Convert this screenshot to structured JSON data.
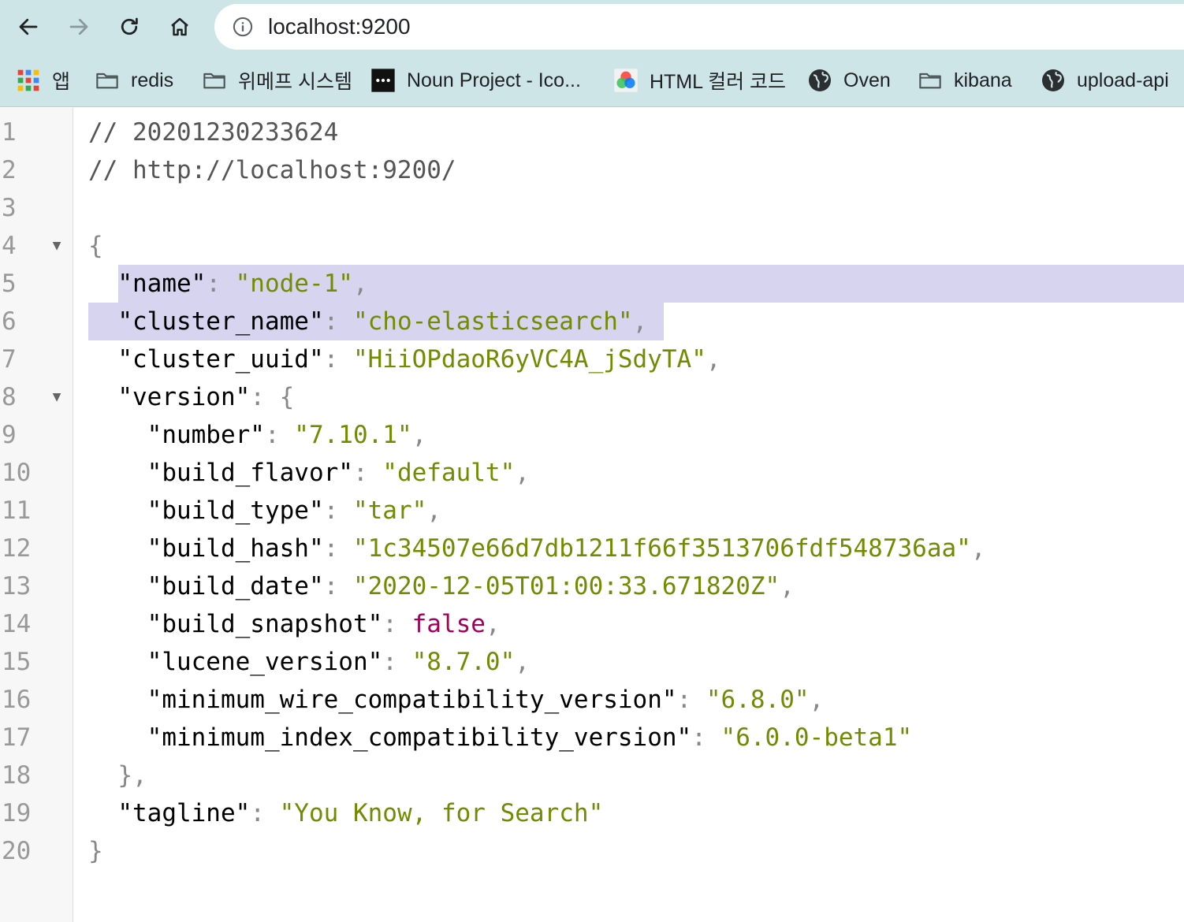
{
  "browser": {
    "url": "localhost:9200",
    "nav_icons": [
      "back-arrow-icon",
      "forward-arrow-icon",
      "reload-icon",
      "home-icon"
    ],
    "bookmarks": [
      {
        "label": "앱",
        "icon": "apps-grid-icon"
      },
      {
        "label": "redis",
        "icon": "folder-icon"
      },
      {
        "label": "위메프 시스템",
        "icon": "folder-icon"
      },
      {
        "label": "Noun Project - Ico...",
        "icon": "noun-project-icon"
      },
      {
        "label": "HTML 컬러 코드",
        "icon": "color-wheel-icon"
      },
      {
        "label": "Oven",
        "icon": "globe-icon"
      },
      {
        "label": "kibana",
        "icon": "folder-icon"
      },
      {
        "label": "upload-api",
        "icon": "globe-icon"
      }
    ]
  },
  "colors": {
    "toolbar_bg": "#cde5e7",
    "string": "#718c00",
    "boolean": "#a2005c",
    "key": "#000000",
    "selection": "#d7d4f0"
  },
  "viewer": {
    "selected_lines": [
      5,
      6
    ],
    "lines": [
      {
        "n": "1",
        "fold": "",
        "parts": [
          {
            "t": "// 20201230233624",
            "c": "c"
          }
        ]
      },
      {
        "n": "2",
        "fold": "",
        "parts": [
          {
            "t": "// http://localhost:9200/",
            "c": "c"
          }
        ]
      },
      {
        "n": "3",
        "fold": "",
        "parts": []
      },
      {
        "n": "4",
        "fold": "▼",
        "parts": [
          {
            "t": "{",
            "c": "p"
          }
        ]
      },
      {
        "n": "5",
        "fold": "",
        "parts": [
          {
            "t": "  ",
            "c": "p"
          },
          {
            "t": "\"name\"",
            "c": "k"
          },
          {
            "t": ": ",
            "c": "p"
          },
          {
            "t": "\"node-1\"",
            "c": "s"
          },
          {
            "t": ",",
            "c": "p"
          }
        ]
      },
      {
        "n": "6",
        "fold": "",
        "parts": [
          {
            "t": "  ",
            "c": "p"
          },
          {
            "t": "\"cluster_name\"",
            "c": "k"
          },
          {
            "t": ": ",
            "c": "p"
          },
          {
            "t": "\"cho-elasticsearch\"",
            "c": "s"
          },
          {
            "t": ",",
            "c": "p"
          }
        ]
      },
      {
        "n": "7",
        "fold": "",
        "parts": [
          {
            "t": "  ",
            "c": "p"
          },
          {
            "t": "\"cluster_uuid\"",
            "c": "k"
          },
          {
            "t": ": ",
            "c": "p"
          },
          {
            "t": "\"HiiOPdaoR6yVC4A_jSdyTA\"",
            "c": "s"
          },
          {
            "t": ",",
            "c": "p"
          }
        ]
      },
      {
        "n": "8",
        "fold": "▼",
        "parts": [
          {
            "t": "  ",
            "c": "p"
          },
          {
            "t": "\"version\"",
            "c": "k"
          },
          {
            "t": ": {",
            "c": "p"
          }
        ]
      },
      {
        "n": "9",
        "fold": "",
        "parts": [
          {
            "t": "    ",
            "c": "p"
          },
          {
            "t": "\"number\"",
            "c": "k"
          },
          {
            "t": ": ",
            "c": "p"
          },
          {
            "t": "\"7.10.1\"",
            "c": "s"
          },
          {
            "t": ",",
            "c": "p"
          }
        ]
      },
      {
        "n": "10",
        "fold": "",
        "parts": [
          {
            "t": "    ",
            "c": "p"
          },
          {
            "t": "\"build_flavor\"",
            "c": "k"
          },
          {
            "t": ": ",
            "c": "p"
          },
          {
            "t": "\"default\"",
            "c": "s"
          },
          {
            "t": ",",
            "c": "p"
          }
        ]
      },
      {
        "n": "11",
        "fold": "",
        "parts": [
          {
            "t": "    ",
            "c": "p"
          },
          {
            "t": "\"build_type\"",
            "c": "k"
          },
          {
            "t": ": ",
            "c": "p"
          },
          {
            "t": "\"tar\"",
            "c": "s"
          },
          {
            "t": ",",
            "c": "p"
          }
        ]
      },
      {
        "n": "12",
        "fold": "",
        "parts": [
          {
            "t": "    ",
            "c": "p"
          },
          {
            "t": "\"build_hash\"",
            "c": "k"
          },
          {
            "t": ": ",
            "c": "p"
          },
          {
            "t": "\"1c34507e66d7db1211f66f3513706fdf548736aa\"",
            "c": "s"
          },
          {
            "t": ",",
            "c": "p"
          }
        ]
      },
      {
        "n": "13",
        "fold": "",
        "parts": [
          {
            "t": "    ",
            "c": "p"
          },
          {
            "t": "\"build_date\"",
            "c": "k"
          },
          {
            "t": ": ",
            "c": "p"
          },
          {
            "t": "\"2020-12-05T01:00:33.671820Z\"",
            "c": "s"
          },
          {
            "t": ",",
            "c": "p"
          }
        ]
      },
      {
        "n": "14",
        "fold": "",
        "parts": [
          {
            "t": "    ",
            "c": "p"
          },
          {
            "t": "\"build_snapshot\"",
            "c": "k"
          },
          {
            "t": ": ",
            "c": "p"
          },
          {
            "t": "false",
            "c": "b"
          },
          {
            "t": ",",
            "c": "p"
          }
        ]
      },
      {
        "n": "15",
        "fold": "",
        "parts": [
          {
            "t": "    ",
            "c": "p"
          },
          {
            "t": "\"lucene_version\"",
            "c": "k"
          },
          {
            "t": ": ",
            "c": "p"
          },
          {
            "t": "\"8.7.0\"",
            "c": "s"
          },
          {
            "t": ",",
            "c": "p"
          }
        ]
      },
      {
        "n": "16",
        "fold": "",
        "parts": [
          {
            "t": "    ",
            "c": "p"
          },
          {
            "t": "\"minimum_wire_compatibility_version\"",
            "c": "k"
          },
          {
            "t": ": ",
            "c": "p"
          },
          {
            "t": "\"6.8.0\"",
            "c": "s"
          },
          {
            "t": ",",
            "c": "p"
          }
        ]
      },
      {
        "n": "17",
        "fold": "",
        "parts": [
          {
            "t": "    ",
            "c": "p"
          },
          {
            "t": "\"minimum_index_compatibility_version\"",
            "c": "k"
          },
          {
            "t": ": ",
            "c": "p"
          },
          {
            "t": "\"6.0.0-beta1\"",
            "c": "s"
          }
        ]
      },
      {
        "n": "18",
        "fold": "",
        "parts": [
          {
            "t": "  },",
            "c": "p"
          }
        ]
      },
      {
        "n": "19",
        "fold": "",
        "parts": [
          {
            "t": "  ",
            "c": "p"
          },
          {
            "t": "\"tagline\"",
            "c": "k"
          },
          {
            "t": ": ",
            "c": "p"
          },
          {
            "t": "\"You Know, for Search\"",
            "c": "s"
          }
        ]
      },
      {
        "n": "20",
        "fold": "",
        "parts": [
          {
            "t": "}",
            "c": "p"
          }
        ]
      }
    ]
  }
}
